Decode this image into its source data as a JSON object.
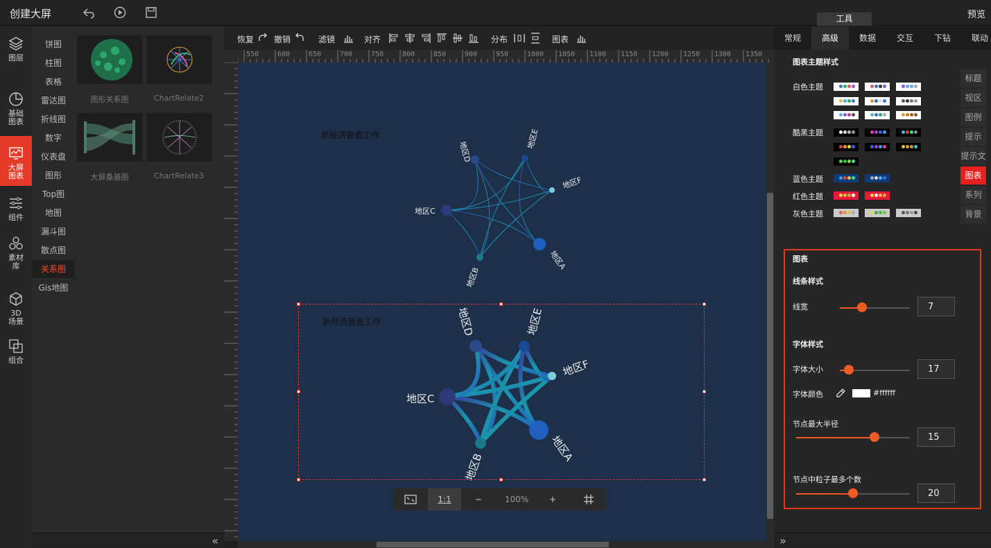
{
  "header": {
    "title": "创建大屏",
    "preview_label": "预览",
    "tools_label": "工具"
  },
  "rail": [
    {
      "label1": "图层",
      "label2": "",
      "icon": "layers-icon"
    },
    {
      "label1": "基础",
      "label2": "图表",
      "icon": "pie-chart-icon"
    },
    {
      "label1": "大屏",
      "label2": "图表",
      "icon": "screen-chart-icon"
    },
    {
      "label1": "组件",
      "label2": "",
      "icon": "sliders-icon"
    },
    {
      "label1": "素材",
      "label2": "库",
      "icon": "material-icon"
    },
    {
      "label1": "3D",
      "label2": "场景",
      "icon": "cube-icon"
    },
    {
      "label1": "组合",
      "label2": "",
      "icon": "group-icon"
    }
  ],
  "categories": [
    "饼图",
    "柱图",
    "表格",
    "雷达图",
    "折线图",
    "数字",
    "仪表盘",
    "图形",
    "Top图",
    "地图",
    "漏斗图",
    "散点图",
    "关系图",
    "Gis地图"
  ],
  "active_category": "关系图",
  "thumbnails": [
    {
      "label": "图形关系图"
    },
    {
      "label": "ChartRelate2"
    },
    {
      "label": "大屏桑基图"
    },
    {
      "label": "ChartRelate3"
    }
  ],
  "canvas_toolbar": {
    "redo": "恢复",
    "undo": "撤销",
    "filter": "滤镜",
    "align": "对齐",
    "distribute": "分布",
    "chart": "图表"
  },
  "ruler_top": [
    "550",
    "600",
    "650",
    "700",
    "750",
    "800",
    "850",
    "900",
    "950",
    "1000",
    "1050",
    "1100",
    "1150",
    "1200",
    "1250",
    "1300",
    "1350"
  ],
  "ruler_left": [
    "0",
    "100",
    "200",
    "300",
    "400",
    "500",
    "600",
    "700",
    "800",
    "900",
    "950",
    "1000"
  ],
  "charts": [
    {
      "title": "新经济普查工作",
      "nodes": [
        "地区D",
        "地区E",
        "地区F",
        "地区C",
        "地区A",
        "地区B"
      ]
    },
    {
      "title": "新经济普查工作",
      "nodes": [
        "地区D",
        "地区E",
        "地区F",
        "地区C",
        "地区A",
        "地区B"
      ]
    }
  ],
  "zoom": {
    "fit_label": "1:1",
    "minus": "−",
    "value": "100%",
    "plus": "+"
  },
  "right_tabs": [
    "常规",
    "高级",
    "数据",
    "交互",
    "下钻",
    "联动"
  ],
  "active_right_tab": "高级",
  "theme_section": {
    "title": "图表主题样式",
    "white": "白色主题",
    "black": "酷黑主题",
    "blue": "蓝色主题",
    "red": "红色主题",
    "gray": "灰色主题"
  },
  "side_tabs": [
    "标题",
    "视区",
    "图例",
    "提示",
    "提示文",
    "图表",
    "系列",
    "背景"
  ],
  "active_side_tab": "图表",
  "chart_section": {
    "title": "图表",
    "line_style": "线条样式",
    "line_width_label": "线宽",
    "line_width": "7",
    "line_width_pct": 0.32,
    "font_style": "字体样式",
    "font_size_label": "字体大小",
    "font_size": "17",
    "font_size_pct": 0.13,
    "font_color_label": "字体颜色",
    "font_color": "#ffffff",
    "node_radius_label": "节点最大半径",
    "node_radius": "15",
    "node_radius_pct": 0.69,
    "particles_label": "节点中粒子最多个数",
    "particles": "20",
    "particles_pct": 0.5
  },
  "colors": {
    "accent": "#f15a24",
    "active_red": "#e63a28",
    "canvas_bg": "#1d2f49"
  }
}
